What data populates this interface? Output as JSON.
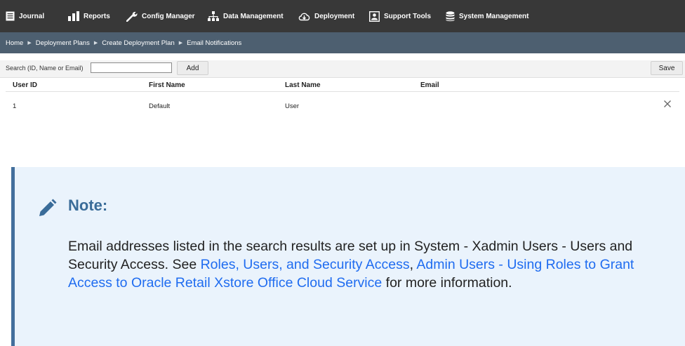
{
  "nav": {
    "items": [
      {
        "label": "Journal",
        "icon": "journal-icon"
      },
      {
        "label": "Reports",
        "icon": "reports-icon"
      },
      {
        "label": "Config Manager",
        "icon": "wrench-icon"
      },
      {
        "label": "Data Management",
        "icon": "hierarchy-icon"
      },
      {
        "label": "Deployment",
        "icon": "cloud-download-icon"
      },
      {
        "label": "Support Tools",
        "icon": "user-box-icon"
      },
      {
        "label": "System Management",
        "icon": "database-icon"
      }
    ]
  },
  "breadcrumb": {
    "items": [
      "Home",
      "Deployment Plans",
      "Create Deployment Plan",
      "Email Notifications"
    ]
  },
  "toolbar": {
    "search_label": "Search (ID, Name or Email)",
    "search_value": "",
    "add_label": "Add",
    "save_label": "Save"
  },
  "table": {
    "columns": [
      "User ID",
      "First Name",
      "Last Name",
      "Email"
    ],
    "rows": [
      {
        "user_id": "1",
        "first_name": "Default",
        "last_name": "User",
        "email": ""
      }
    ]
  },
  "note": {
    "title": "Note:",
    "text_before": "Email addresses listed in the search results are set up in System - Xadmin Users - Users and Security Access. See ",
    "link1": "Roles, Users, and Security Access",
    "text_middle": ", ",
    "link2": "Admin Users - Using Roles to Grant Access to Oracle Retail Xstore Office Cloud Service",
    "text_after": " for more information."
  },
  "colors": {
    "nav_bg": "#383838",
    "breadcrumb_bg": "#4d5f70",
    "note_bg": "#eaf3fc",
    "note_accent": "#436f9c",
    "link": "#1f6cf0"
  }
}
